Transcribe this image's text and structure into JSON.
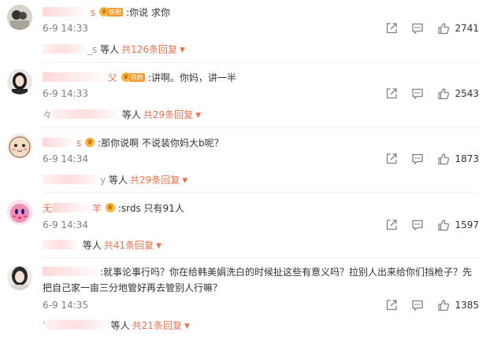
{
  "comments": [
    {
      "name_visible": "s",
      "badge_label": "铁粉",
      "text": ":你说 求你",
      "time": "6-9 14:33",
      "likes": "2741",
      "reply_prefix": "_s",
      "reply_suffix": "等人",
      "reply_more": "共126条回复"
    },
    {
      "name_visible": "父",
      "badge_label": "铁粉",
      "text": ":讲啊。你妈，讲一半",
      "time": "6-9 14:33",
      "likes": "2543",
      "reply_prefix": "々",
      "reply_suffix": "等人",
      "reply_more": "共29条回复"
    },
    {
      "name_visible": "s",
      "text": ":那你说啊 不说装你妈大b呢？",
      "time": "6-9 14:34",
      "likes": "1873",
      "reply_prefix": "y",
      "reply_suffix": "等人",
      "reply_more": "共29条回复"
    },
    {
      "name_visible_start": "无",
      "name_visible": "羊",
      "text": ":srds 只有91人",
      "time": "6-9 14:34",
      "likes": "1597",
      "reply_suffix": "等人",
      "reply_more": "共41条回复"
    },
    {
      "text": ":就事论事行吗？你在给韩美娟洗白的时候扯这些有意义吗？拉别人出来给你们挡枪子？先",
      "text_line2": "把自己家一亩三分地管好再去管别人行嘛？",
      "time": "6-9 14:35",
      "likes": "1385",
      "reply_prefix": "’",
      "reply_suffix": "等人",
      "reply_more": "共21条回复"
    }
  ],
  "icons": {
    "share": "share-icon",
    "comment": "comment-icon",
    "like": "thumbs-up-icon",
    "reply_caret": "caret-down-icon"
  },
  "colors": {
    "accent": "#eb7350",
    "time": "#808080",
    "icon": "#808080"
  }
}
